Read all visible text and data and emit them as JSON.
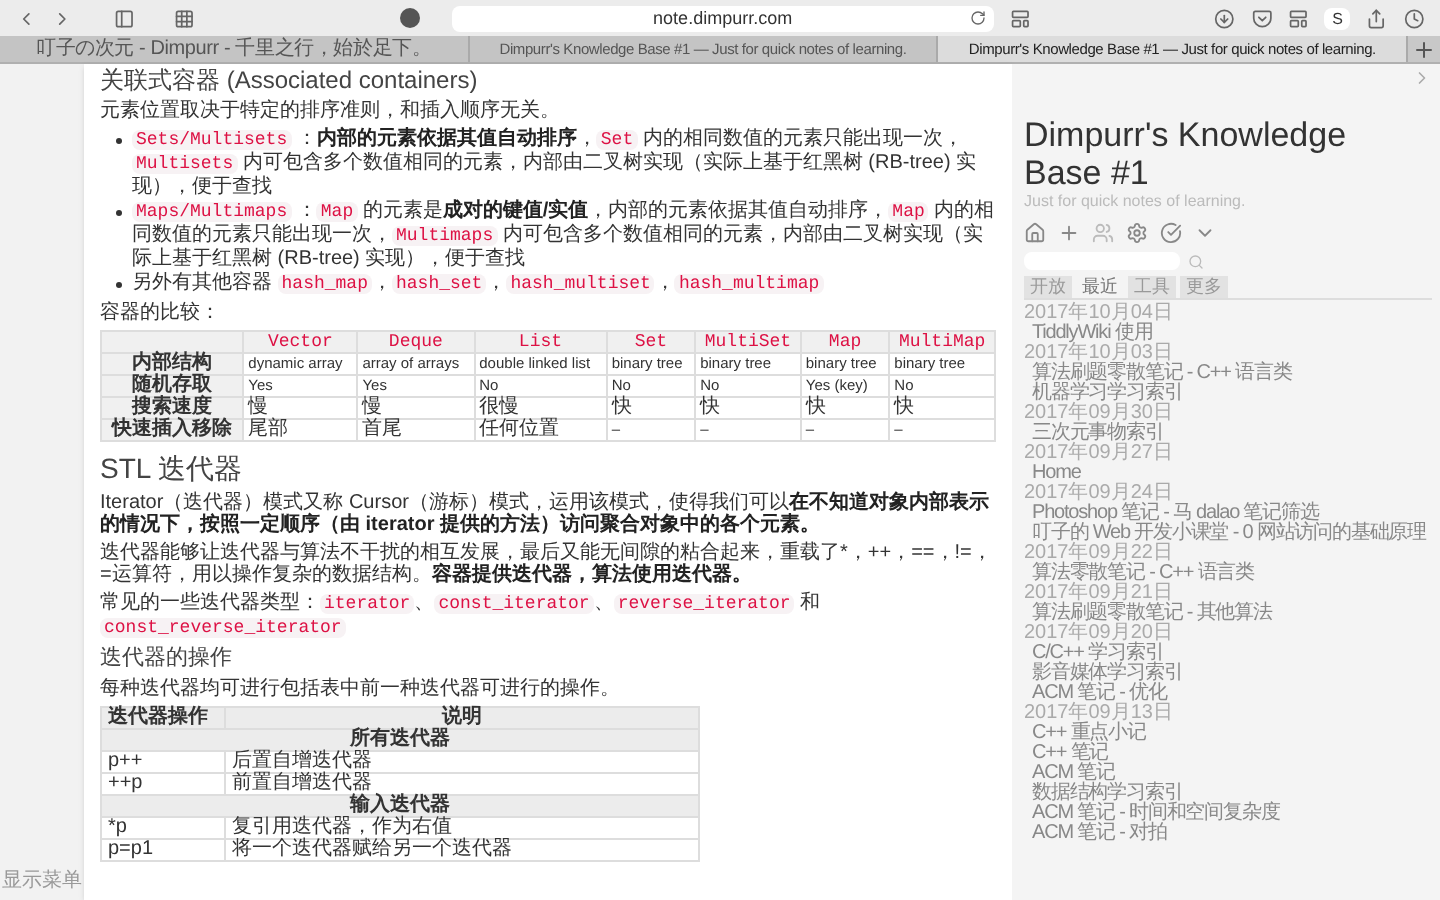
{
  "browser": {
    "address": "note.dimpurr.com",
    "extension_label": "S",
    "tabs": [
      {
        "title": "叮子の次元 - Dimpurr - 千里之行，始於足下。",
        "selected": false
      },
      {
        "title": "Dimpurr's Knowledge Base #1 — Just for quick notes of learning.",
        "selected": false
      },
      {
        "title": "Dimpurr's Knowledge Base #1 — Just for quick notes of learning.",
        "selected": true
      }
    ]
  },
  "left_panel": {
    "menu_label": "显示菜单"
  },
  "article": {
    "heading": "关联式容器 (Associated containers)",
    "intro": "元素位置取决于特定的排序准则，和插入顺序无关。",
    "bullets": [
      [
        {
          "kind": "code",
          "text": "Sets/Multisets"
        },
        {
          "kind": "text",
          "text": " ："
        },
        {
          "kind": "bold",
          "text": "内部的元素依据其值自动排序"
        },
        {
          "kind": "text",
          "text": "，"
        },
        {
          "kind": "code",
          "text": "Set"
        },
        {
          "kind": "text",
          "text": " 内的相同数值的元素只能出现一次，"
        },
        {
          "kind": "code",
          "text": "Multisets"
        },
        {
          "kind": "text",
          "text": " 内可包含多个数值相同的元素，内部由二叉树实现（实际上基于红黑树 (RB-tree) 实现），便于查找"
        }
      ],
      [
        {
          "kind": "code",
          "text": "Maps/Multimaps"
        },
        {
          "kind": "text",
          "text": " ："
        },
        {
          "kind": "code",
          "text": "Map"
        },
        {
          "kind": "text",
          "text": " 的元素是"
        },
        {
          "kind": "bold",
          "text": "成对的键值/实值"
        },
        {
          "kind": "text",
          "text": "，内部的元素依据其值自动排序，"
        },
        {
          "kind": "code",
          "text": "Map"
        },
        {
          "kind": "text",
          "text": " 内的相同数值的元素只能出现一次，"
        },
        {
          "kind": "code",
          "text": "Multimaps"
        },
        {
          "kind": "text",
          "text": " 内可包含多个数值相同的元素，内部由二叉树实现（实际上基于红黑树 (RB-tree) 实现），便于查找"
        }
      ],
      [
        {
          "kind": "text",
          "text": "另外有其他容器 "
        },
        {
          "kind": "code",
          "text": "hash_map"
        },
        {
          "kind": "text",
          "text": "，"
        },
        {
          "kind": "code",
          "text": "hash_set"
        },
        {
          "kind": "text",
          "text": "，"
        },
        {
          "kind": "code",
          "text": "hash_multiset"
        },
        {
          "kind": "text",
          "text": "，"
        },
        {
          "kind": "code",
          "text": "hash_multimap"
        }
      ]
    ],
    "compare_label": "容器的比较：",
    "compare_table": {
      "columns": [
        "Vector",
        "Deque",
        "List",
        "Set",
        "MultiSet",
        "Map",
        "MultiMap"
      ],
      "rows": [
        {
          "header": "内部结构",
          "cells": [
            "dynamic array",
            "array of arrays",
            "double linked list",
            "binary tree",
            "binary tree",
            "binary tree",
            "binary tree"
          ]
        },
        {
          "header": "随机存取",
          "cells": [
            "Yes",
            "Yes",
            "No",
            "No",
            "No",
            "Yes (key)",
            "No"
          ]
        },
        {
          "header": "搜索速度",
          "cells": [
            "慢",
            "慢",
            "很慢",
            "快",
            "快",
            "快",
            "快"
          ]
        },
        {
          "header": "快速插入移除",
          "cells": [
            "尾部",
            "首尾",
            "任何位置",
            "–",
            "–",
            "–",
            "–"
          ]
        }
      ]
    },
    "section_title": "STL 迭代器",
    "paragraphs": [
      [
        {
          "kind": "text",
          "text": "Iterator（迭代器）模式又称 Cursor（游标）模式，运用该模式，使得我们可以"
        },
        {
          "kind": "bold",
          "text": "在不知道对象内部表示的情况下，按照一定顺序（由 iterator 提供的方法）访问聚合对象中的各个元素。"
        }
      ],
      [
        {
          "kind": "text",
          "text": "迭代器能够让迭代器与算法不干扰的相互发展，最后又能无间隙的粘合起来，重载了*，++，==，!=，=运算符，用以操作复杂的数据结构。"
        },
        {
          "kind": "bold",
          "text": "容器提供迭代器，算法使用迭代器。"
        }
      ],
      [
        {
          "kind": "text",
          "text": "常见的一些迭代器类型："
        },
        {
          "kind": "code",
          "text": "iterator"
        },
        {
          "kind": "text",
          "text": "、"
        },
        {
          "kind": "code",
          "text": "const_iterator"
        },
        {
          "kind": "text",
          "text": "、"
        },
        {
          "kind": "code",
          "text": "reverse_iterator"
        },
        {
          "kind": "text",
          "text": " 和 "
        },
        {
          "kind": "code",
          "text": "const_reverse_iterator"
        }
      ]
    ],
    "ops_heading": "迭代器的操作",
    "ops_intro": "每种迭代器均可进行包括表中前一种迭代器可进行的操作。",
    "ops_table": {
      "columns": [
        "迭代器操作",
        "说明"
      ],
      "rows": [
        {
          "kind": "group",
          "label": "所有迭代器"
        },
        {
          "kind": "row",
          "op": "p++",
          "desc": "后置自增迭代器"
        },
        {
          "kind": "row",
          "op": "++p",
          "desc": "前置自增迭代器"
        },
        {
          "kind": "group",
          "label": "输入迭代器"
        },
        {
          "kind": "row",
          "op": "*p",
          "desc": "复引用迭代器，作为右值"
        },
        {
          "kind": "row",
          "op": "p=p1",
          "desc": "将一个迭代器赋给另一个迭代器"
        }
      ]
    }
  },
  "sidebar": {
    "title": "Dimpurr's Knowledge Base #1",
    "subtitle": "Just for quick notes of learning.",
    "tabs": [
      {
        "label": "开放",
        "selected": false
      },
      {
        "label": "最近",
        "selected": true
      },
      {
        "label": "工具",
        "selected": false
      },
      {
        "label": "更多",
        "selected": false
      }
    ],
    "recent": [
      {
        "date": "2017年10月04日",
        "items": [
          "TiddlyWiki 使用"
        ]
      },
      {
        "date": "2017年10月03日",
        "items": [
          "算法刷题零散笔记 - C++ 语言类",
          "机器学习学习索引"
        ]
      },
      {
        "date": "2017年09月30日",
        "items": [
          "三次元事物索引"
        ]
      },
      {
        "date": "2017年09月27日",
        "items": [
          "Home"
        ]
      },
      {
        "date": "2017年09月24日",
        "items": [
          "Photoshop 笔记 - 马 dalao 笔记筛选",
          "叮子的 Web 开发小课堂 - 0 网站访问的基础原理"
        ]
      },
      {
        "date": "2017年09月22日",
        "items": [
          "算法零散笔记 - C++ 语言类"
        ]
      },
      {
        "date": "2017年09月21日",
        "items": [
          "算法刷题零散笔记 - 其他算法"
        ]
      },
      {
        "date": "2017年09月20日",
        "items": [
          "C/C++ 学习索引",
          "影音媒体学习索引",
          "ACM 笔记 - 优化"
        ]
      },
      {
        "date": "2017年09月13日",
        "items": [
          "C++ 重点小记",
          "C++ 笔记",
          "ACM 笔记",
          "数据结构学习索引",
          "ACM 笔记 - 时间和空间复杂度",
          "ACM 笔记 - 对拍"
        ]
      }
    ]
  }
}
